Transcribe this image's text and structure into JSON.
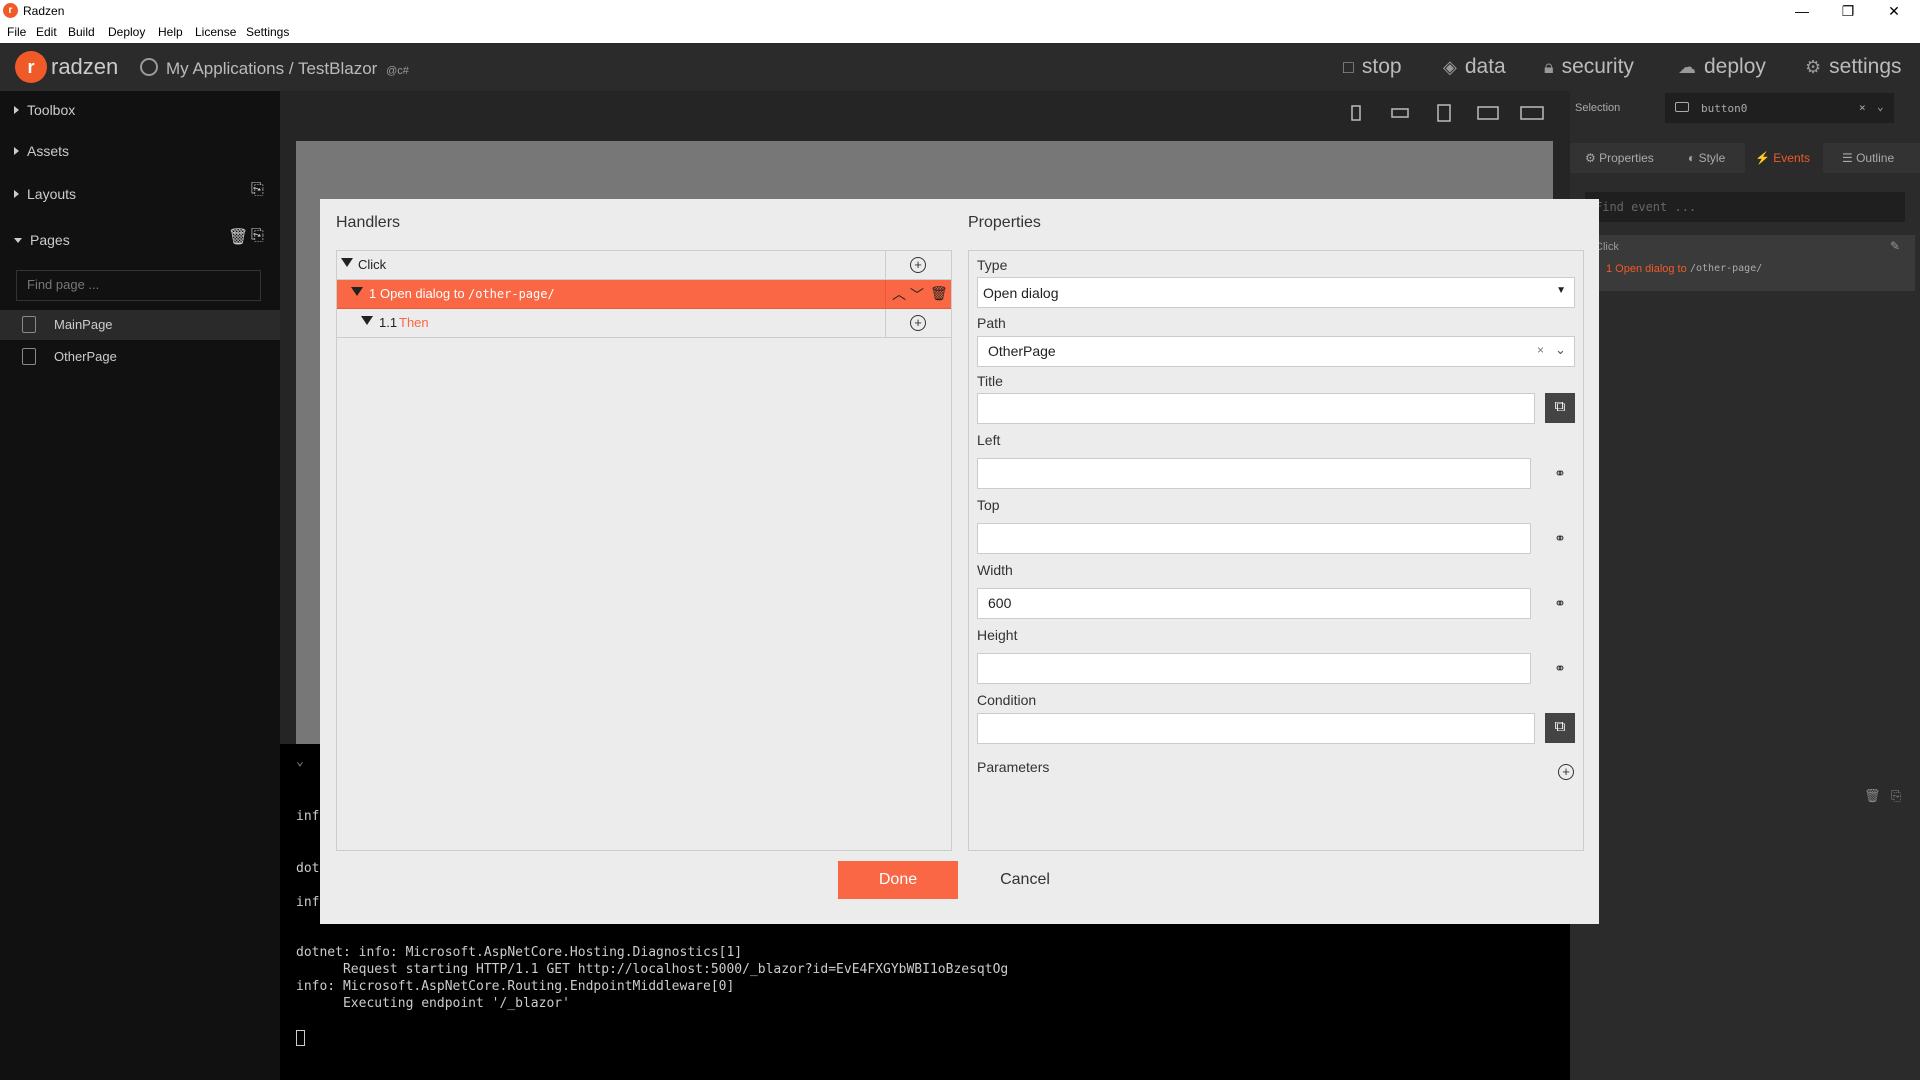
{
  "window": {
    "title": "Radzen",
    "minimize": "—",
    "restore": "❐",
    "close": "✕"
  },
  "menu": [
    "File",
    "Edit",
    "Build",
    "Deploy",
    "Help",
    "License",
    "Settings"
  ],
  "header": {
    "brand": "radzen",
    "breadcrumb": "My Applications / TestBlazor",
    "breadcrumb_tag": "c#",
    "nav": [
      {
        "label": "stop",
        "icon": "stop-icon"
      },
      {
        "label": "data",
        "icon": "layers-icon"
      },
      {
        "label": "security",
        "icon": "lock-icon"
      },
      {
        "label": "deploy",
        "icon": "cloud-upload-icon"
      },
      {
        "label": "settings",
        "icon": "gear-icon"
      }
    ]
  },
  "sidebar": {
    "sections": [
      "Toolbox",
      "Assets",
      "Layouts",
      "Pages"
    ],
    "find_placeholder": "Find page ...",
    "pages": [
      "MainPage",
      "OtherPage"
    ]
  },
  "console": {
    "lines": [
      "inf",
      "dot",
      "inf",
      "dotnet: info: Microsoft.AspNetCore.Hosting.Diagnostics[1]",
      "      Request starting HTTP/1.1 GET http://localhost:5000/_blazor?id=EvE4FXGYbWBI1oBzesqtOg",
      "info: Microsoft.AspNetCore.Routing.EndpointMiddleware[0]",
      "      Executing endpoint '/_blazor'"
    ]
  },
  "right_panel": {
    "selection_label": "Selection",
    "selection_value": "button0",
    "tabs": [
      "Properties",
      "Style",
      "Events",
      "Outline"
    ],
    "active_tab": "Events",
    "find_placeholder": "Find event ...",
    "event_name": "Click",
    "event_entry_prefix": "1 Open dialog to",
    "event_entry_path": "/other-page/"
  },
  "dialog": {
    "handlers_title": "Handlers",
    "properties_title": "Properties",
    "handlers": {
      "event": "Click",
      "action_number": "1",
      "action_label": "Open dialog to",
      "action_path": "/other-page/",
      "then_number": "1.1",
      "then_label": "Then"
    },
    "properties": {
      "type_label": "Type",
      "type_value": "Open dialog",
      "path_label": "Path",
      "path_value": "OtherPage",
      "title_label": "Title",
      "title_value": "",
      "left_label": "Left",
      "left_value": "",
      "top_label": "Top",
      "top_value": "",
      "width_label": "Width",
      "width_value": "600",
      "height_label": "Height",
      "height_value": "",
      "condition_label": "Condition",
      "condition_value": "",
      "parameters_label": "Parameters"
    },
    "done_label": "Done",
    "cancel_label": "Cancel"
  },
  "colors": {
    "accent": "#f96744",
    "brand": "#f05a28"
  }
}
